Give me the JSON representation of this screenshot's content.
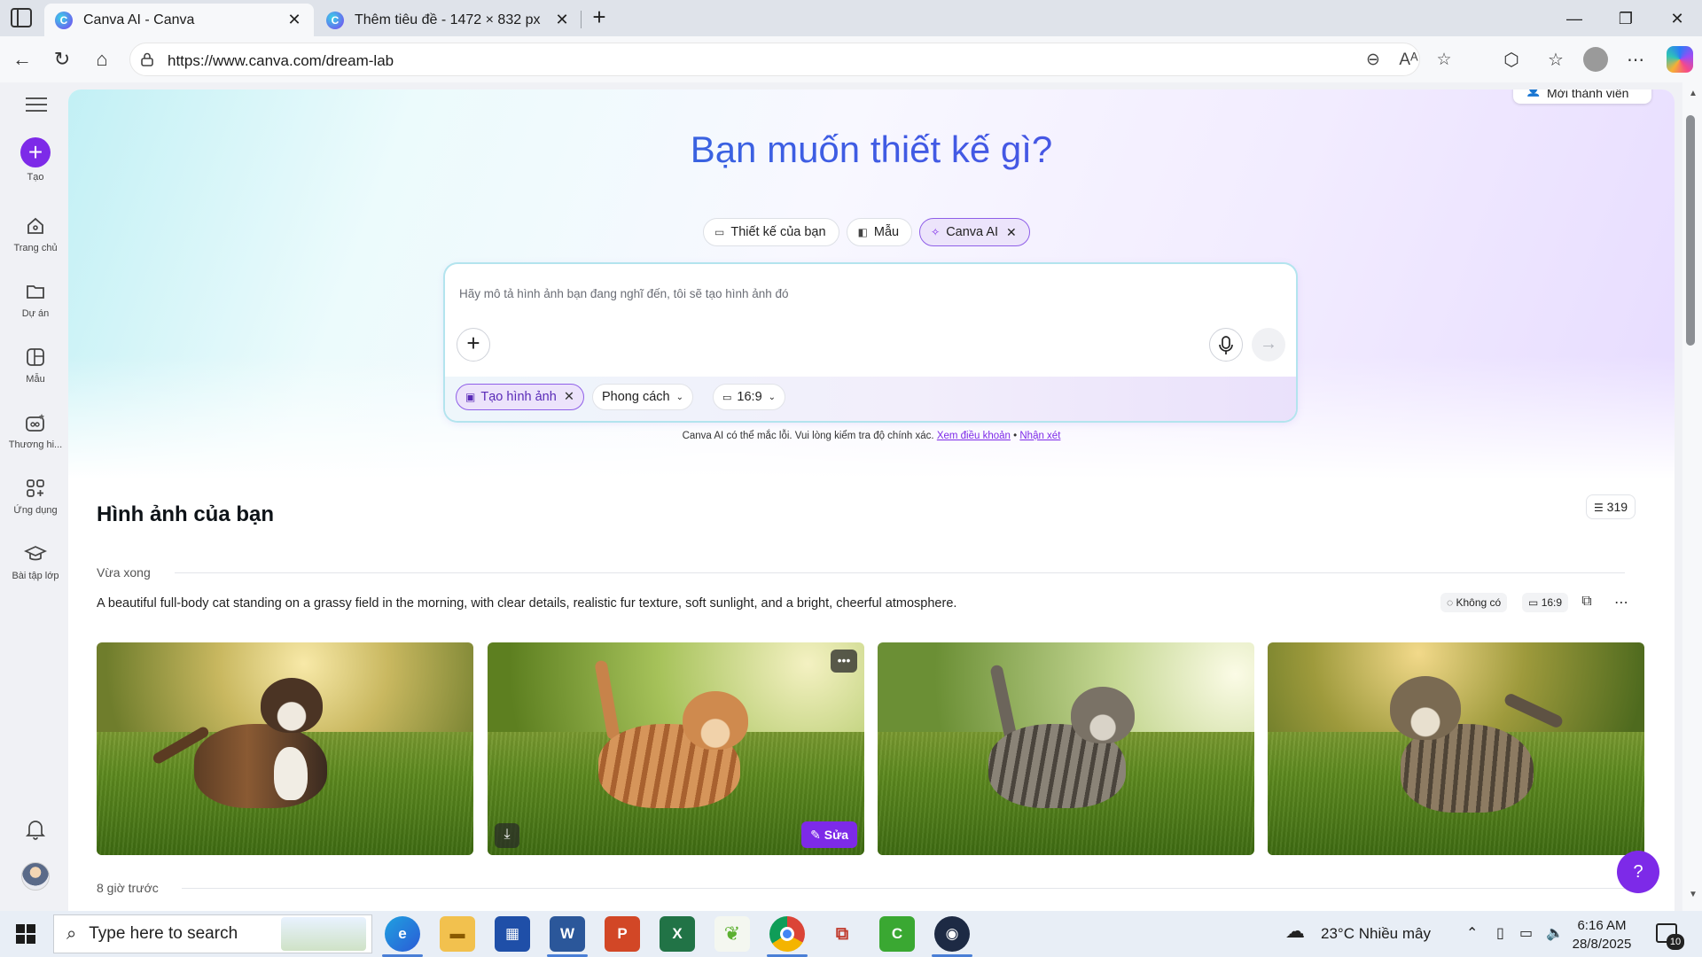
{
  "browser": {
    "tabs": [
      {
        "title": "Canva AI - Canva",
        "active": true
      },
      {
        "title": "Thêm tiêu đề - 1472 × 832 px",
        "active": false
      }
    ],
    "url": "https://www.canva.com/dream-lab"
  },
  "sidebar": {
    "items": [
      {
        "label": "Tạo",
        "icon": "plus-icon"
      },
      {
        "label": "Trang chủ",
        "icon": "home-icon"
      },
      {
        "label": "Dự án",
        "icon": "folder-icon"
      },
      {
        "label": "Mẫu",
        "icon": "template-icon"
      },
      {
        "label": "Thương hi...",
        "icon": "brand-icon"
      },
      {
        "label": "Ứng dụng",
        "icon": "apps-icon"
      },
      {
        "label": "Bài tập lớp",
        "icon": "graduation-cap-icon"
      }
    ]
  },
  "header": {
    "invite_label": "Mời thành viên",
    "title": "Bạn muốn thiết kế gì?",
    "pills": [
      {
        "label": "Thiết kế của bạn"
      },
      {
        "label": "Mẫu"
      },
      {
        "label": "Canva AI"
      }
    ]
  },
  "prompt": {
    "placeholder": "Hãy mô tả hình ảnh bạn đang nghĩ đến, tôi sẽ tạo hình ảnh đó",
    "chip_mode": "Tạo hình ảnh",
    "chip_style": "Phong cách",
    "chip_ratio": "16:9"
  },
  "disclaimer": {
    "text": "Canva AI có thể mắc lỗi. Vui lòng kiểm tra độ chính xác.",
    "terms_link": "Xem điều khoản",
    "separator": "•",
    "feedback_link": "Nhận xét"
  },
  "gallery": {
    "title": "Hình ảnh của bạn",
    "count": "319",
    "group_recent": "Vừa xong",
    "group_earlier": "8 giờ trước",
    "prompt_text": "A beautiful full-body cat standing on a grassy field in the morning, with clear details, realistic fur texture, soft sunlight, and a bright, cheerful atmosphere.",
    "style_chip": "Không có",
    "ratio_chip": "16:9",
    "edit_label": "Sửa"
  },
  "taskbar": {
    "search_placeholder": "Type here to search",
    "weather": "23°C  Nhiều mây",
    "time": "6:16 AM",
    "date": "28/8/2025",
    "notifications": "10"
  },
  "colors": {
    "accent": "#7d2ae8",
    "title_gradient_start": "#1e7fd0",
    "title_gradient_end": "#5b46e6"
  }
}
